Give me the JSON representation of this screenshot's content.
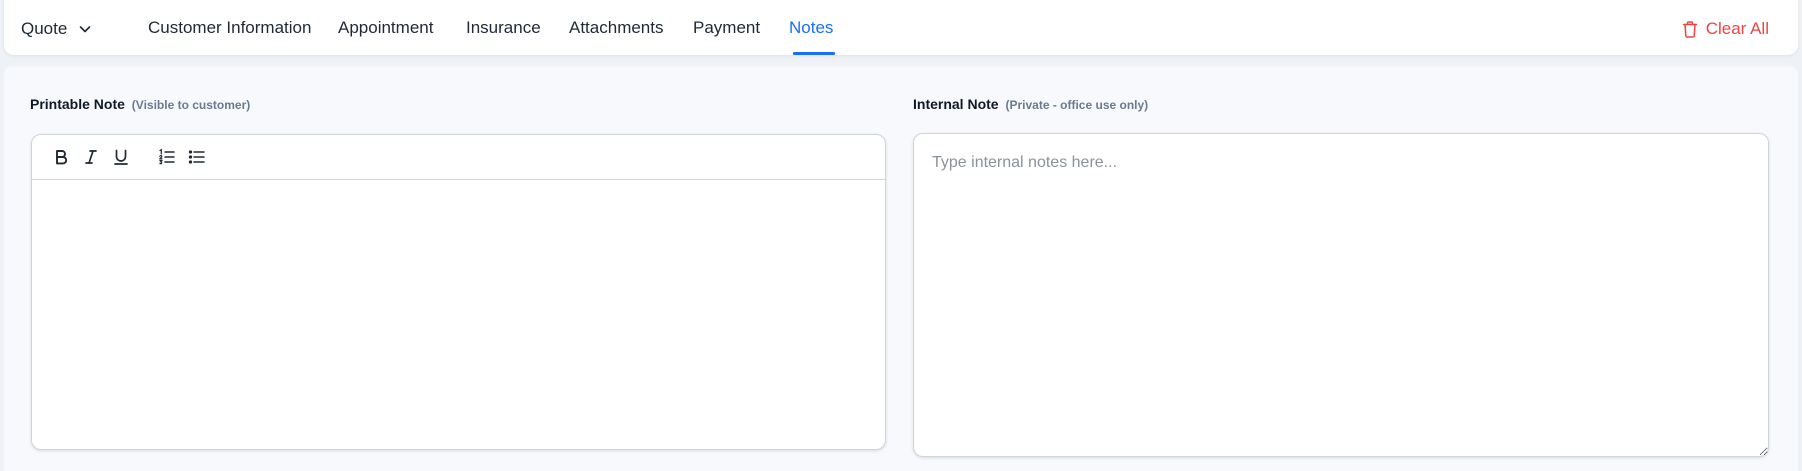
{
  "header": {
    "doc_type": "Quote",
    "tabs": [
      {
        "label": "Customer Information"
      },
      {
        "label": "Appointment"
      },
      {
        "label": "Insurance"
      },
      {
        "label": "Attachments"
      },
      {
        "label": "Payment"
      },
      {
        "label": "Notes",
        "active": true
      }
    ],
    "clear_all": "Clear All"
  },
  "printable_note": {
    "label": "Printable Note",
    "hint": "(Visible to customer)",
    "toolbar": [
      "bold-icon",
      "italic-icon",
      "underline-icon",
      "ordered-list-icon",
      "bullet-list-icon"
    ]
  },
  "internal_note": {
    "label": "Internal Note",
    "hint": "(Private - office use only)",
    "placeholder": "Type internal notes here...",
    "value": ""
  },
  "colors": {
    "accent": "#1a6ff5",
    "danger": "#ef4444",
    "background": "#eef1f5"
  }
}
